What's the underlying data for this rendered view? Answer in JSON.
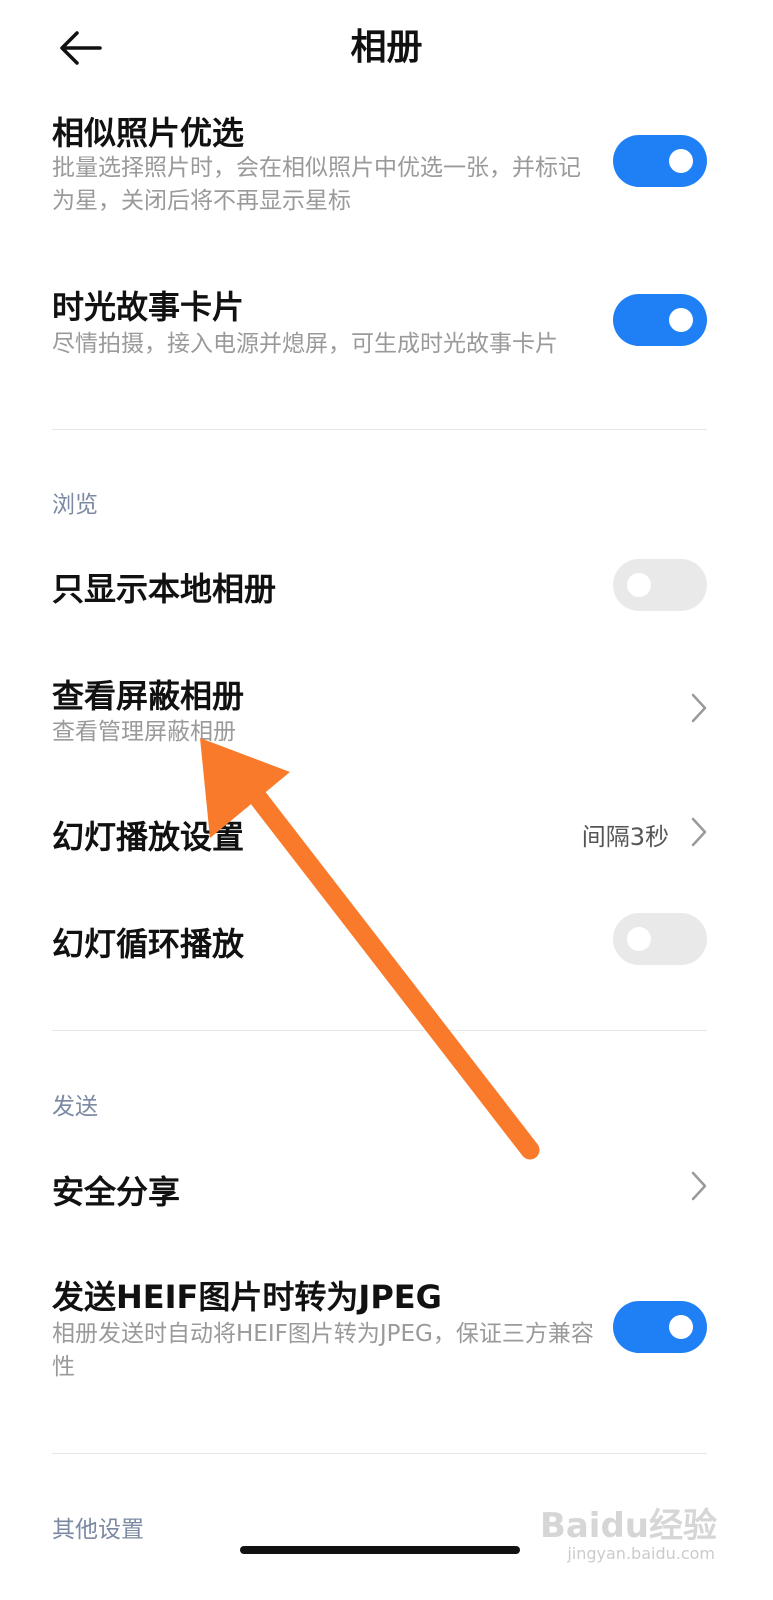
{
  "header": {
    "title": "相册",
    "back_icon": "back-arrow-icon"
  },
  "settings": {
    "similar_photos": {
      "title": "相似照片优选",
      "desc": "批量选择照片时，会在相似照片中优选一张，并标记为星，关闭后将不再显示星标",
      "enabled": true
    },
    "story_card": {
      "title": "时光故事卡片",
      "desc": "尽情拍摄，接入电源并熄屏，可生成时光故事卡片",
      "enabled": true
    }
  },
  "browse": {
    "section_label": "浏览",
    "local_only": {
      "title": "只显示本地相册",
      "enabled": false
    },
    "hidden_albums": {
      "title": "查看屏蔽相册",
      "desc": "查看管理屏蔽相册"
    },
    "slideshow_settings": {
      "title": "幻灯播放设置",
      "value": "间隔3秒"
    },
    "slideshow_loop": {
      "title": "幻灯循环播放",
      "enabled": false
    }
  },
  "send": {
    "section_label": "发送",
    "secure_share": {
      "title": "安全分享"
    },
    "heif_to_jpeg": {
      "title": "发送HEIF图片时转为JPEG",
      "desc": "相册发送时自动将HEIF图片转为JPEG，保证三方兼容性",
      "enabled": true
    }
  },
  "other": {
    "section_label": "其他设置"
  },
  "watermark": {
    "text": "Baidu经验",
    "subtext": "jingyan.baidu.com"
  },
  "colors": {
    "accent": "#1f80f5",
    "annotation_arrow": "#f97a2b",
    "section_label": "#7b89a3"
  }
}
